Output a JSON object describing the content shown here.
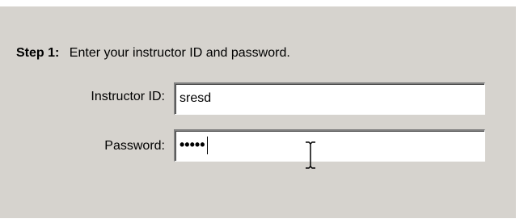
{
  "step": {
    "label": "Step 1:",
    "instruction": "Enter your instructor ID and password."
  },
  "instructor_id": {
    "label": "Instructor ID:",
    "value": "sresd"
  },
  "password": {
    "label": "Password:",
    "masked_value": "•••••"
  },
  "cursor": {
    "icon": "text-cursor-icon"
  }
}
